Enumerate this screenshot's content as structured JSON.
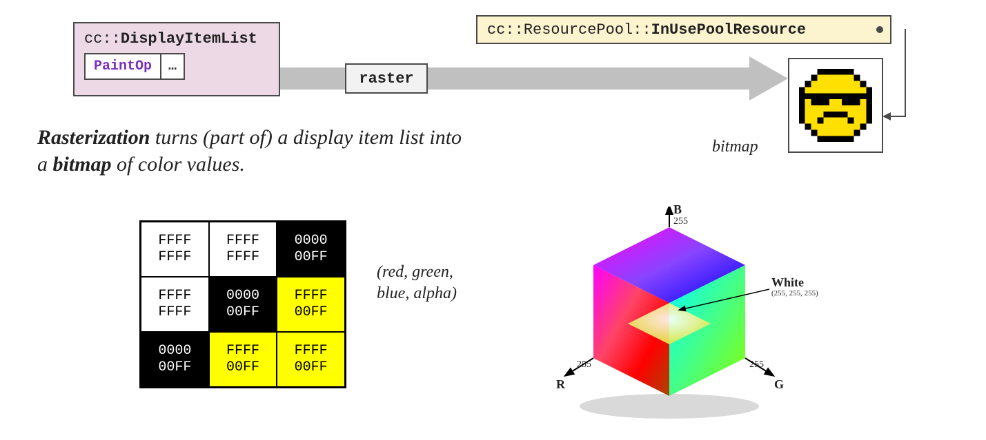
{
  "displayItemList": {
    "namespace": "cc::",
    "className": "DisplayItemList",
    "paintOpLabel": "PaintOp",
    "ellipsis": "…"
  },
  "arrow": {
    "label": "raster"
  },
  "resourcePool": {
    "namespace": "cc::",
    "middle": "ResourcePool::",
    "className": "InUsePoolResource"
  },
  "bitmapLabel": "bitmap",
  "description": {
    "lead": "Rasterization",
    "mid": " turns (part of) a display item list into a ",
    "bitmapWord": "bitmap",
    "tail": " of color values."
  },
  "colorGrid": {
    "rows": [
      [
        {
          "class": "white-cell",
          "line1": "FFFF",
          "line2": "FFFF"
        },
        {
          "class": "white-cell",
          "line1": "FFFF",
          "line2": "FFFF"
        },
        {
          "class": "black-cell",
          "line1": "0000",
          "line2": "00FF"
        }
      ],
      [
        {
          "class": "white-cell",
          "line1": "FFFF",
          "line2": "FFFF"
        },
        {
          "class": "black-cell",
          "line1": "0000",
          "line2": "00FF"
        },
        {
          "class": "yellow-cell",
          "line1": "FFFF",
          "line2": "00FF"
        }
      ],
      [
        {
          "class": "black-cell",
          "line1": "0000",
          "line2": "00FF"
        },
        {
          "class": "yellow-cell",
          "line1": "FFFF",
          "line2": "00FF"
        },
        {
          "class": "yellow-cell",
          "line1": "FFFF",
          "line2": "00FF"
        }
      ]
    ]
  },
  "rgbaLabel": {
    "line1": "(red, green,",
    "line2": " blue, alpha)"
  },
  "cube": {
    "B": "B",
    "R": "R",
    "G": "G",
    "B255": "255",
    "R255": "255",
    "G255": "255",
    "white": "White",
    "whiteSub": "(255, 255, 255)"
  }
}
